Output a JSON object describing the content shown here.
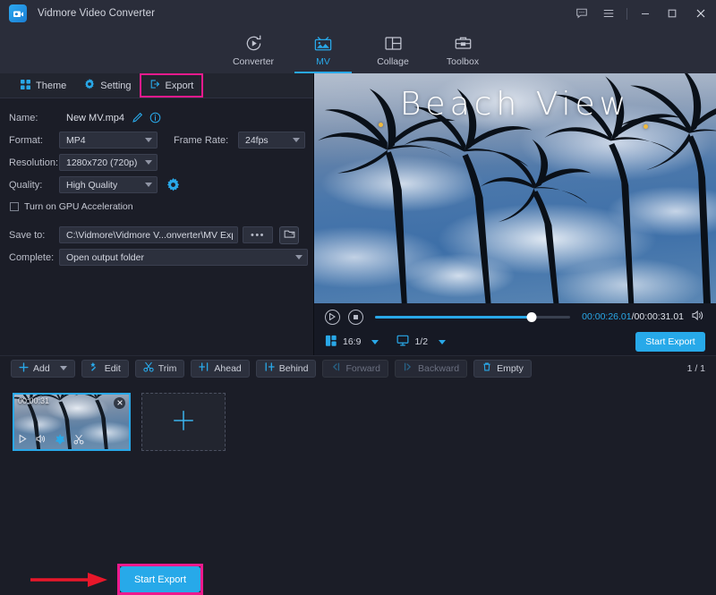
{
  "window": {
    "app_title": "Vidmore Video Converter",
    "logo_icon": "video-camera-logo-icon",
    "controls": [
      {
        "name": "feedback-button",
        "icon": "speech-bubble-icon"
      },
      {
        "name": "menu-button",
        "icon": "hamburger-menu-icon"
      },
      {
        "name": "minimize-button",
        "icon": "minimize-icon"
      },
      {
        "name": "maximize-button",
        "icon": "maximize-icon"
      },
      {
        "name": "close-button",
        "icon": "close-x-icon"
      }
    ]
  },
  "nav": {
    "active": "MV",
    "tabs": [
      {
        "label": "Converter",
        "icon": "refresh-play-icon",
        "active": false
      },
      {
        "label": "MV",
        "icon": "picture-tv-icon",
        "active": true
      },
      {
        "label": "Collage",
        "icon": "grid-layout-icon",
        "active": false
      },
      {
        "label": "Toolbox",
        "icon": "toolbox-icon",
        "active": false
      }
    ]
  },
  "subtabs": {
    "items": [
      {
        "label": "Theme",
        "icon": "four-squares-icon",
        "highlighted": false
      },
      {
        "label": "Setting",
        "icon": "gear-icon",
        "highlighted": false
      },
      {
        "label": "Export",
        "icon": "export-arrow-icon",
        "highlighted": true
      }
    ],
    "highlight_color": "#ec1a8d"
  },
  "form": {
    "name_label": "Name:",
    "name_value": "New MV.mp4",
    "edit_icon": "pencil-edit-icon",
    "info_icon": "info-circle-icon",
    "format_label": "Format:",
    "format_value": "MP4",
    "framerate_label": "Frame Rate:",
    "framerate_value": "24fps",
    "resolution_label": "Resolution:",
    "resolution_value": "1280x720 (720p)",
    "quality_label": "Quality:",
    "quality_value": "High Quality",
    "quality_settings_icon": "gear-icon",
    "gpu_label": "Turn on GPU Acceleration",
    "gpu_checked": false,
    "saveto_label": "Save to:",
    "saveto_value": "C:\\Vidmore\\Vidmore V...onverter\\MV Exported",
    "browse_dots": "•••",
    "folder_icon": "folder-open-icon",
    "complete_label": "Complete:",
    "complete_value": "Open output folder"
  },
  "export": {
    "button_label": "Start Export",
    "button_color": "#27a9e9",
    "highlight_color": "#ec1a8d",
    "arrow_color": "#e8172a",
    "arrow_icon": "right-arrow-annotation-icon"
  },
  "preview": {
    "mv_title": "Beach View",
    "image_description": "palm trees silhouetted against cloudy blue sky"
  },
  "player": {
    "play_icon": "play-circle-icon",
    "stop_icon": "stop-circle-icon",
    "progress_percent": 80,
    "current_time": "00:00:26.01",
    "total_time": "/00:00:31.01",
    "volume_icon": "speaker-volume-icon",
    "aspect_icon": "aspect-ratio-icon",
    "aspect_value": "16:9",
    "screen_icon": "monitor-screen-icon",
    "screen_value": "1/2",
    "start_export_label": "Start Export"
  },
  "toolbar": {
    "buttons": [
      {
        "label": "Add",
        "icon": "plus-icon",
        "has_caret": true,
        "disabled": false
      },
      {
        "label": "Edit",
        "icon": "magic-wand-icon",
        "has_caret": false,
        "disabled": false
      },
      {
        "label": "Trim",
        "icon": "scissors-icon",
        "has_caret": false,
        "disabled": false
      },
      {
        "label": "Ahead",
        "icon": "insert-ahead-icon",
        "has_caret": false,
        "disabled": false
      },
      {
        "label": "Behind",
        "icon": "insert-behind-icon",
        "has_caret": false,
        "disabled": false
      },
      {
        "label": "Forward",
        "icon": "move-forward-icon",
        "has_caret": false,
        "disabled": true
      },
      {
        "label": "Backward",
        "icon": "move-backward-icon",
        "has_caret": false,
        "disabled": true
      },
      {
        "label": "Empty",
        "icon": "trash-icon",
        "has_caret": false,
        "disabled": false
      }
    ],
    "page_indicator": "1 / 1"
  },
  "strip": {
    "clip_time": "00:00:31",
    "close_icon": "close-circle-icon",
    "clip_tools": [
      {
        "name": "play-icon",
        "active": false
      },
      {
        "name": "volume-icon",
        "active": false
      },
      {
        "name": "effect-star-icon",
        "active": true
      },
      {
        "name": "trim-scissors-icon",
        "active": false
      }
    ],
    "add_icon": "plus-icon"
  }
}
